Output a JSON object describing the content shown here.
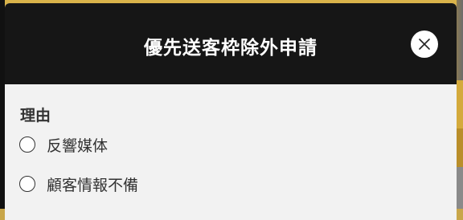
{
  "modal": {
    "title": "優先送客枠除外申請",
    "close_icon": "close-icon",
    "close_button_color": "#ffffff",
    "header_color": "#161616"
  },
  "form": {
    "section_label": "理由",
    "options": [
      {
        "label": "反響媒体",
        "selected": false
      },
      {
        "label": "顧客情報不備",
        "selected": false
      }
    ]
  }
}
